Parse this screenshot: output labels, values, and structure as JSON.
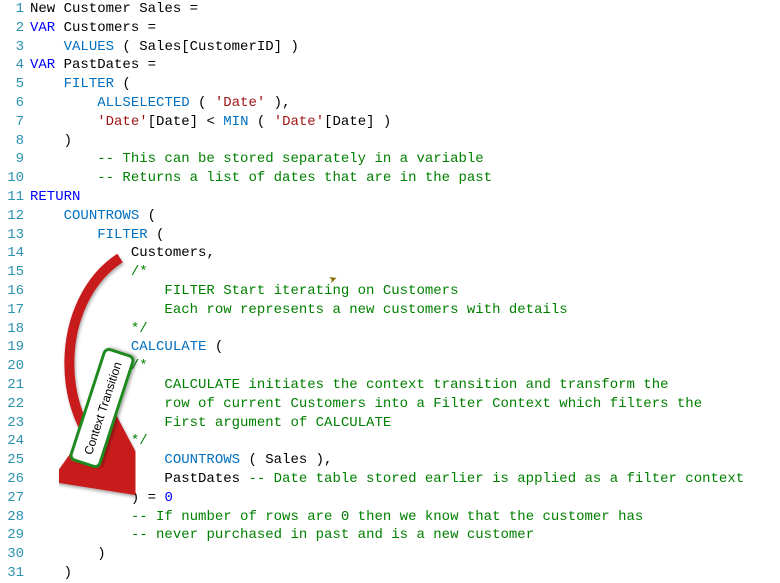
{
  "lines": {
    "l1": {
      "num": "1",
      "t1": "New Customer Sales ="
    },
    "l2": {
      "num": "2",
      "kw": "VAR",
      "t": " Customers ="
    },
    "l3": {
      "num": "3",
      "pad": "    ",
      "fn": "VALUES",
      "t": " ( Sales[CustomerID] )"
    },
    "l4": {
      "num": "4",
      "kw": "VAR",
      "t": " PastDates ="
    },
    "l5": {
      "num": "5",
      "pad": "    ",
      "fn": "FILTER",
      "t": " ("
    },
    "l6": {
      "num": "6",
      "pad": "        ",
      "fn": "ALLSELECTED",
      "t1": " ( ",
      "s": "'Date'",
      "t2": " ),"
    },
    "l7": {
      "num": "7",
      "pad": "        ",
      "s1": "'Date'",
      "t1": "[Date] < ",
      "fn": "MIN",
      "t2": " ( ",
      "s2": "'Date'",
      "t3": "[Date] )"
    },
    "l8": {
      "num": "8",
      "pad": "    ",
      "t": ")"
    },
    "l9": {
      "num": "9",
      "pad": "        ",
      "c": "-- This can be stored separately in a variable"
    },
    "l10": {
      "num": "10",
      "pad": "        ",
      "c": "-- Returns a list of dates that are in the past"
    },
    "l11": {
      "num": "11",
      "kw": "RETURN"
    },
    "l12": {
      "num": "12",
      "pad": "    ",
      "fn": "COUNTROWS",
      "t": " ("
    },
    "l13": {
      "num": "13",
      "pad": "        ",
      "fn": "FILTER",
      "t": " ("
    },
    "l14": {
      "num": "14",
      "pad": "            ",
      "t": "Customers,"
    },
    "l15": {
      "num": "15",
      "pad": "            ",
      "c": "/*"
    },
    "l16": {
      "num": "16",
      "pad": "                ",
      "c": "FILTER Start iterating on Customers"
    },
    "l17": {
      "num": "17",
      "pad": "                ",
      "c": "Each row represents a new customers with details"
    },
    "l18": {
      "num": "18",
      "pad": "            ",
      "c": "*/"
    },
    "l19": {
      "num": "19",
      "pad": "            ",
      "fn": "CALCULATE",
      "t": " ("
    },
    "l20": {
      "num": "20",
      "pad": "            ",
      "c": "/*"
    },
    "l21": {
      "num": "21",
      "pad": "                ",
      "c": "CALCULATE initiates the context transition and transform the"
    },
    "l22": {
      "num": "22",
      "pad": "                ",
      "c": "row of current Customers into a Filter Context which filters the"
    },
    "l23": {
      "num": "23",
      "pad": "                ",
      "c": "First argument of CALCULATE"
    },
    "l24": {
      "num": "24",
      "pad": "            ",
      "c": "*/"
    },
    "l25": {
      "num": "25",
      "pad": "                ",
      "fn": "COUNTROWS",
      "t": " ( Sales ),"
    },
    "l26": {
      "num": "26",
      "pad": "                ",
      "t": "PastDates ",
      "c": "-- Date table stored earlier is applied as a filter context"
    },
    "l27": {
      "num": "27",
      "pad": "            ",
      "t1": ") = ",
      "n": "0"
    },
    "l28": {
      "num": "28",
      "pad": "            ",
      "c": "-- If number of rows are 0 then we know that the customer has"
    },
    "l29": {
      "num": "29",
      "pad": "            ",
      "c": "-- never purchased in past and is a new customer"
    },
    "l30": {
      "num": "30",
      "pad": "        ",
      "t": ")"
    },
    "l31": {
      "num": "31",
      "pad": "    ",
      "t": ")"
    }
  },
  "annotation": {
    "label": "Context Transition"
  }
}
